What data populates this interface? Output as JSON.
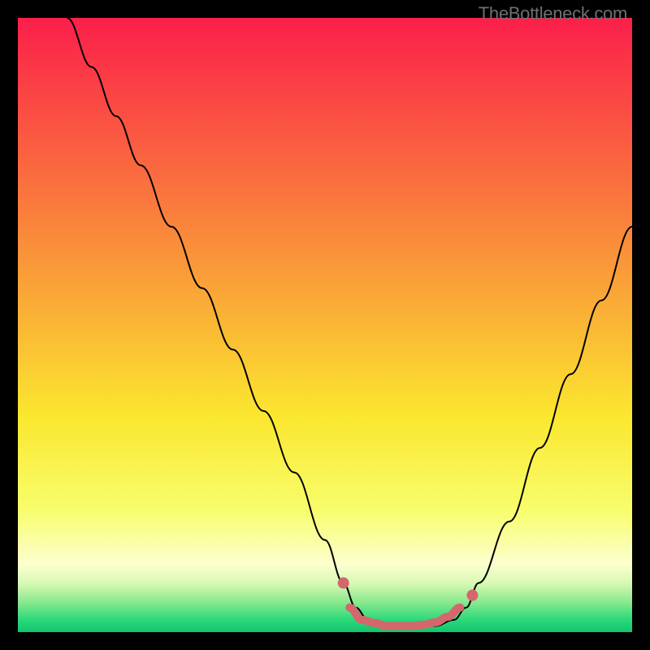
{
  "attribution": "TheBottleneck.com",
  "chart_data": {
    "type": "line",
    "title": "",
    "xlabel": "",
    "ylabel": "",
    "xlim": [
      0,
      100
    ],
    "ylim": [
      0,
      100
    ],
    "grid": false,
    "series": [
      {
        "name": "bottleneck-curve",
        "x": [
          8,
          12,
          16,
          20,
          25,
          30,
          35,
          40,
          45,
          50,
          53,
          55,
          57,
          60,
          64,
          68,
          71,
          73,
          75,
          80,
          85,
          90,
          95,
          100
        ],
        "y": [
          100,
          92,
          84,
          76,
          66,
          56,
          46,
          36,
          26,
          15,
          8,
          4,
          2,
          1,
          1,
          1,
          2,
          4,
          8,
          18,
          30,
          42,
          54,
          66
        ],
        "color": "#000000"
      }
    ],
    "markers": [
      {
        "name": "pink-marker-left",
        "x": 53,
        "cy": 8,
        "r": 7,
        "color": "#d4676c"
      },
      {
        "name": "pink-marker-right",
        "x": 74,
        "cy": 6,
        "r": 7,
        "color": "#d4676c"
      }
    ],
    "pink_trough": {
      "color": "#d4676c",
      "width": 10,
      "x": [
        54,
        56,
        58,
        60,
        62,
        64,
        66,
        68,
        70,
        72
      ],
      "y": [
        4,
        2,
        1.5,
        1,
        1,
        1,
        1.2,
        1.6,
        2.5,
        4
      ]
    },
    "background_gradient": {
      "stops": [
        {
          "offset": 0,
          "color": "#fb1f4a"
        },
        {
          "offset": 40,
          "color": "#fa9739"
        },
        {
          "offset": 65,
          "color": "#fbe72f"
        },
        {
          "offset": 80,
          "color": "#f8fd6b"
        },
        {
          "offset": 89,
          "color": "#fbffce"
        },
        {
          "offset": 92,
          "color": "#d9f9b4"
        },
        {
          "offset": 95,
          "color": "#8de98f"
        },
        {
          "offset": 98,
          "color": "#2bd97a"
        },
        {
          "offset": 100,
          "color": "#11c46e"
        }
      ]
    }
  }
}
